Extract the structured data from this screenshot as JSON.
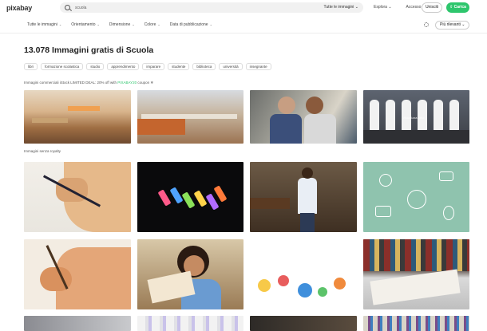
{
  "header": {
    "logo": "pixabay",
    "search_placeholder": "scuola",
    "search_type": "Tutte le immagini ⌄",
    "links": [
      "Esplora ⌄",
      "Accesso"
    ],
    "join_label": "Unisciti",
    "upload_label": "⇧ Carica"
  },
  "filters": {
    "items": [
      "Tutte le immagini",
      "Orientamento",
      "Dimensione",
      "Colore",
      "Data di pubblicazione"
    ],
    "sort_label": "Più rilevanti ⌄"
  },
  "main": {
    "title": "13.078 Immagini gratis di Scuola",
    "tags": [
      "libri",
      "formazione scolastica",
      "studio",
      "apprendimento",
      "imparare",
      "studente",
      "biblioteca",
      "università",
      "insegnante"
    ],
    "promo_text": "Immagini commerciali iStock LIMITED DEAL: 20% off with",
    "promo_code": "PIXABAY20",
    "promo_tail": "coupon ❄",
    "ad_caption": "Visualizza altro",
    "free_caption": "Immagini senza royalty"
  },
  "colors": {
    "accent": "#2ec66d",
    "background": "#ffffff",
    "chalk": [
      "#ff5a8a",
      "#4fa3ff",
      "#8be15a",
      "#ffd34a",
      "#b06bff",
      "#ff7a3a"
    ]
  }
}
